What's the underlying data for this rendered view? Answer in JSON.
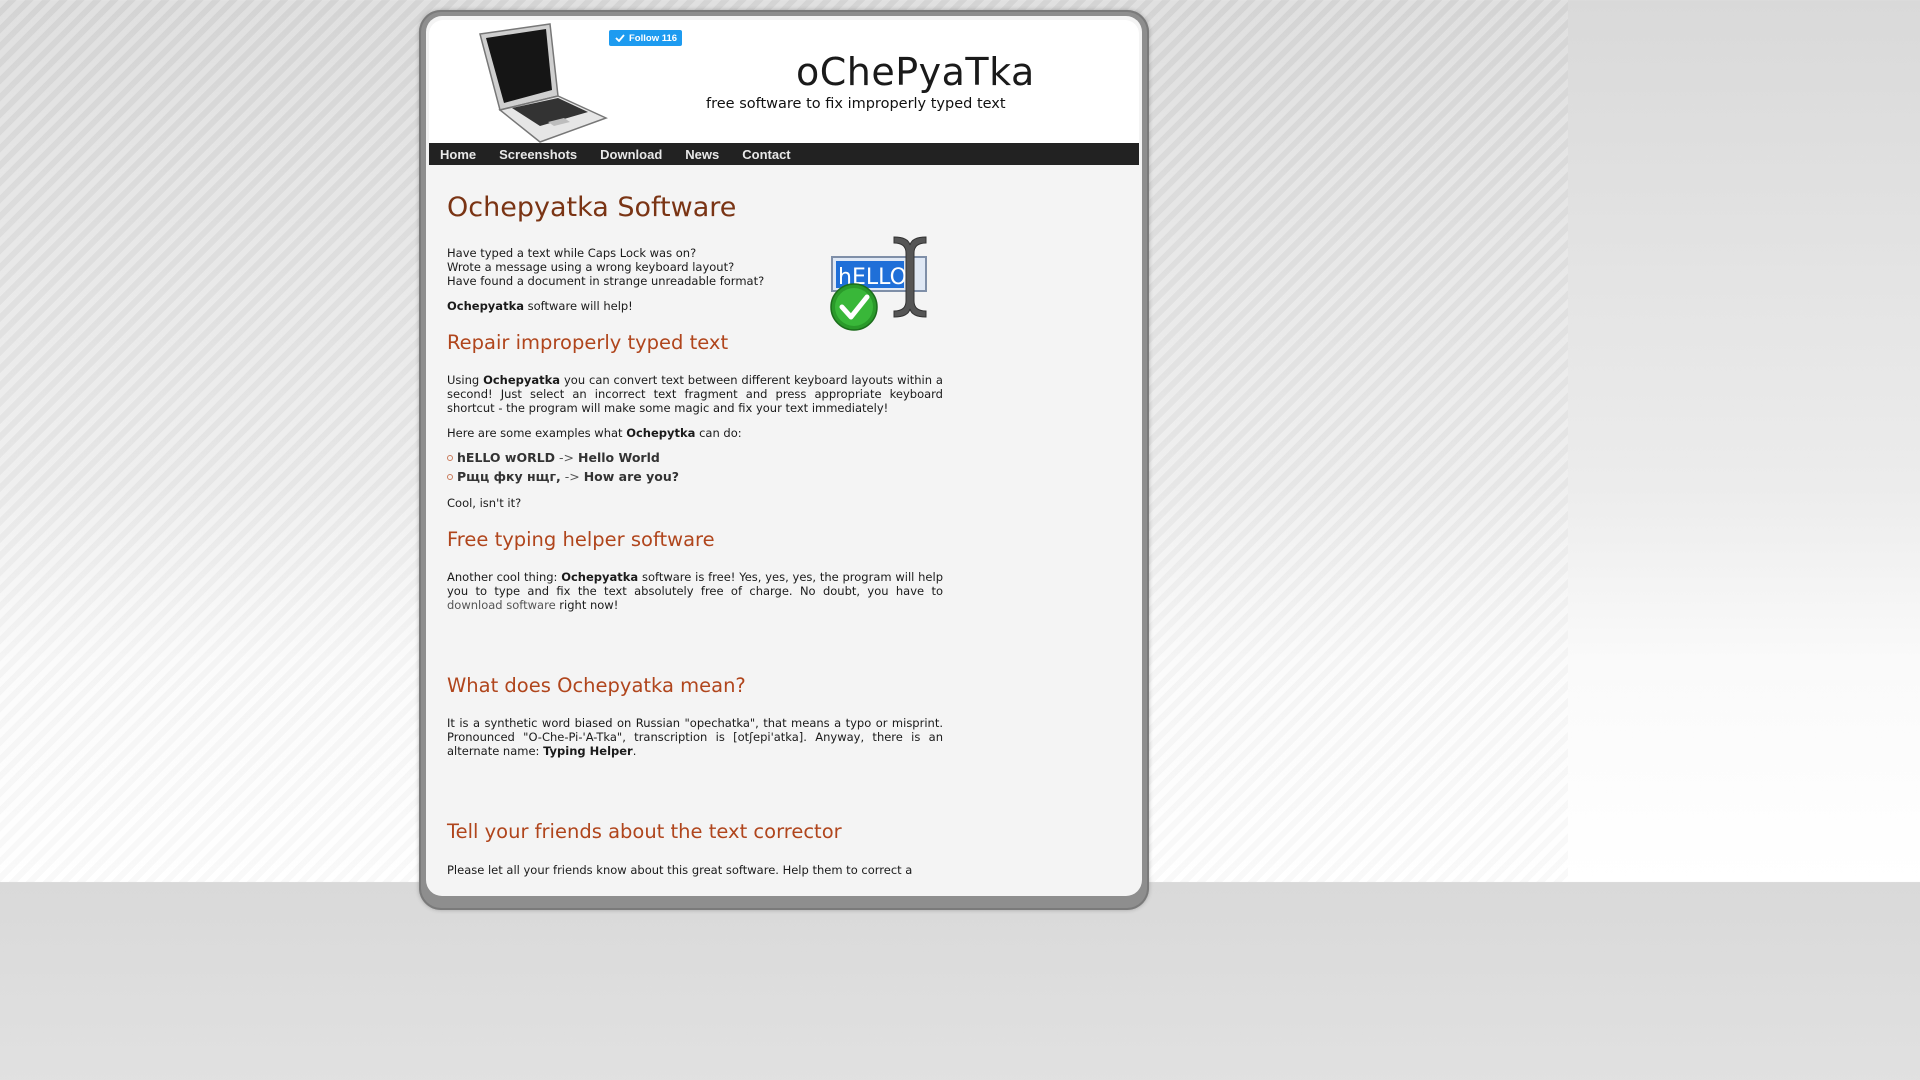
{
  "header": {
    "follow_label": "Follow 116",
    "title": "oChePyaTka",
    "tagline": "free software to fix improperly typed text"
  },
  "nav": [
    "Home",
    "Screenshots",
    "Download",
    "News",
    "Contact"
  ],
  "main": {
    "h1": "Ochepyatka Software",
    "intro": [
      "Have typed a text while Caps Lock was on?",
      "Wrote a message using a wrong keyboard layout?",
      "Have found a document in strange unreadable format?"
    ],
    "help_bold": "Ochepyatka",
    "help_rest": " software will help!",
    "logo_text": "hELLO",
    "s1_title": "Repair improperly typed text",
    "s1_p_pre": "Using ",
    "s1_p_bold": "Ochepyatka",
    "s1_p_post": " you can convert text between different keyboard layouts within a second! Just select an incorrect text fragment and press appropriate keyboard shortcut - the program will make some magic and fix your text immediately!",
    "examples_pre": "Here are some examples what ",
    "examples_bold": "Ochepytka",
    "examples_post": " can do:",
    "examples": [
      {
        "from": "hELLO wORLD",
        "arrow": "->",
        "to": "Hello World"
      },
      {
        "from": "Рщц фку нщг,",
        "arrow": "->",
        "to": "How are you?"
      }
    ],
    "cool": "Cool, isn't it?",
    "s2_title": "Free typing helper software",
    "s2_p_pre": "Another cool thing: ",
    "s2_p_bold": "Ochepyatka",
    "s2_p_mid": " software is free! Yes, yes, yes, the program will help you to type and fix the text absolutely free of charge. No doubt, you have to ",
    "s2_link": "download software",
    "s2_p_post": " right now!",
    "s3_title": "What does Ochepyatka mean?",
    "s3_p_pre": "It is a synthetic word biased on Russian \"opechatka\", that means a typo or misprint. Pronounced \"O-Che-Pi-'A-Tka\", transcription is [otʃepi'atka]. Anyway, there is an alternate name: ",
    "s3_p_bold": "Typing Helper",
    "s3_p_post": ".",
    "s4_title": "Tell your friends about the text corrector",
    "s4_p": "Please let all your friends know about this great software. Help them to correct a"
  },
  "colors": {
    "heading": "#b0451c",
    "title": "#7a3414",
    "nav_bg": "#222222",
    "follow": "#1d9bf0"
  }
}
